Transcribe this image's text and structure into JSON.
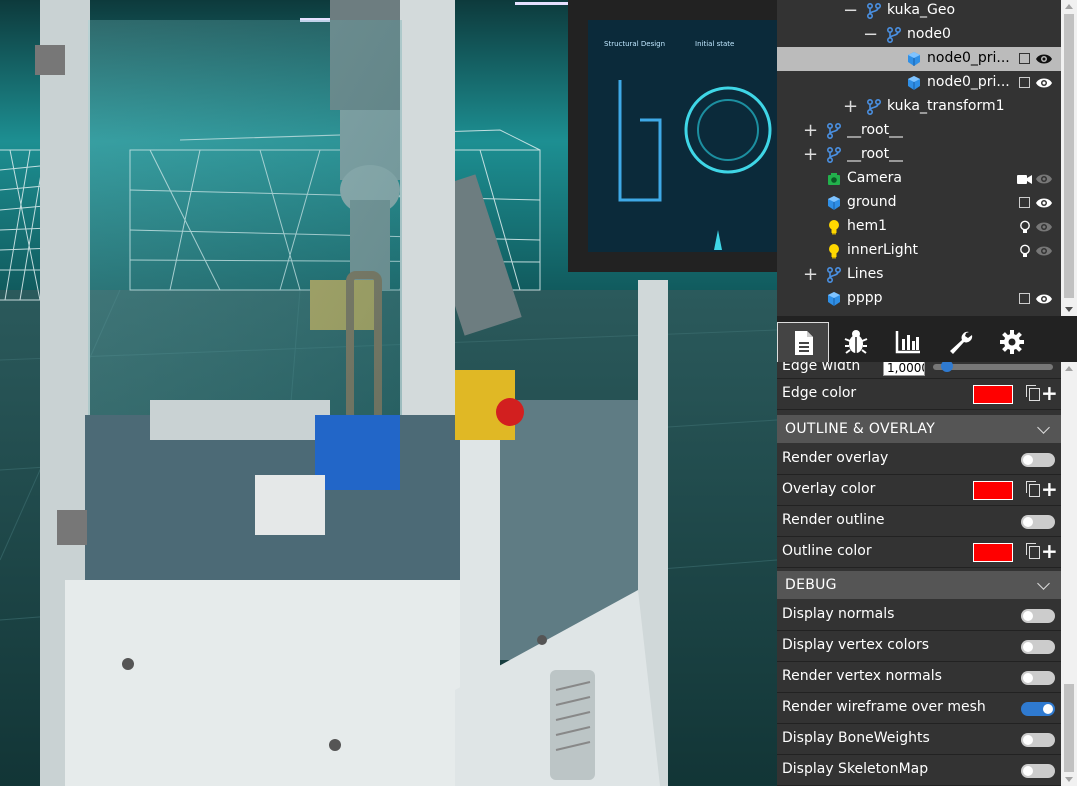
{
  "scene": {
    "screen_title": "Structural Design",
    "screen_state": "Initial state"
  },
  "scene_tree": {
    "items": [
      {
        "label": "kuka_Geo",
        "expander": "−",
        "type": "transform-icon",
        "visibility": "none"
      },
      {
        "label": "node0",
        "expander": "−",
        "type": "transform-icon",
        "visibility": "none"
      },
      {
        "label": "node0_pri...",
        "expander": "",
        "type": "mesh-icon",
        "visibility": "eye",
        "selected": true
      },
      {
        "label": "node0_pri...",
        "expander": "",
        "type": "mesh-icon",
        "visibility": "eye"
      },
      {
        "label": "kuka_transform1",
        "expander": "+",
        "type": "transform-icon",
        "visibility": "none"
      },
      {
        "label": "__root__",
        "expander": "+",
        "type": "transform-icon",
        "visibility": "none"
      },
      {
        "label": "__root__",
        "expander": "+",
        "type": "transform-icon",
        "visibility": "none"
      },
      {
        "label": "Camera",
        "expander": "",
        "type": "camera-icon",
        "visibility": "camera"
      },
      {
        "label": "ground",
        "expander": "",
        "type": "mesh-icon",
        "visibility": "eye"
      },
      {
        "label": "hem1",
        "expander": "",
        "type": "light-icon",
        "visibility": "light"
      },
      {
        "label": "innerLight",
        "expander": "",
        "type": "light-icon",
        "visibility": "light"
      },
      {
        "label": "Lines",
        "expander": "+",
        "type": "transform-icon",
        "visibility": "none"
      },
      {
        "label": "pppp",
        "expander": "",
        "type": "mesh-icon",
        "visibility": "eye"
      }
    ]
  },
  "tabs": [
    {
      "name": "properties",
      "icon": "file-icon",
      "active": true
    },
    {
      "name": "debug",
      "icon": "bug-icon"
    },
    {
      "name": "statistics",
      "icon": "chart-icon"
    },
    {
      "name": "tools",
      "icon": "wrench-icon"
    },
    {
      "name": "settings",
      "icon": "gear-icon"
    }
  ],
  "properties": {
    "edge_width": {
      "label": "Edge width",
      "value": "1,0000",
      "slider_fraction": 0.12
    },
    "edge_color": {
      "label": "Edge color",
      "color": "#ff0000"
    },
    "outline_overlay": {
      "title": "OUTLINE & OVERLAY",
      "render_overlay": {
        "label": "Render overlay",
        "on": false
      },
      "overlay_color": {
        "label": "Overlay color",
        "color": "#ff0000"
      },
      "render_outline": {
        "label": "Render outline",
        "on": false
      },
      "outline_color": {
        "label": "Outline color",
        "color": "#ff0000"
      }
    },
    "debug": {
      "title": "DEBUG",
      "display_normals": {
        "label": "Display normals",
        "on": false
      },
      "display_vertex_colors": {
        "label": "Display vertex colors",
        "on": false
      },
      "render_vertex_normals": {
        "label": "Render vertex normals",
        "on": false
      },
      "render_wireframe": {
        "label": "Render wireframe over mesh",
        "on": true
      },
      "display_boneweights": {
        "label": "Display BoneWeights",
        "on": false
      },
      "display_skeletonmap": {
        "label": "Display SkeletonMap",
        "on": false
      }
    }
  },
  "colors": {
    "accent": "#2f7ad0",
    "panel_bg": "#333333",
    "section_bg": "#555555",
    "selected_row": "#bbbbbb"
  }
}
